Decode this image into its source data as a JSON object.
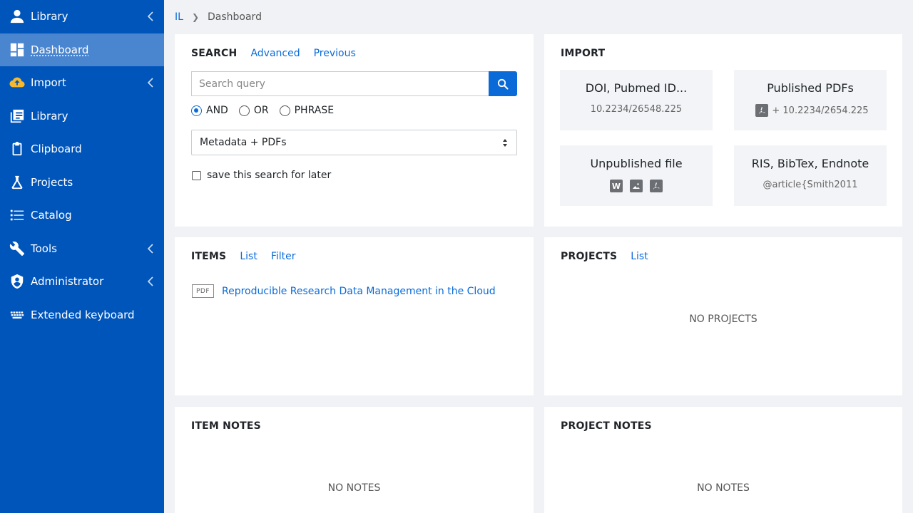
{
  "sidebar": {
    "items": [
      {
        "label": "Library",
        "icon": "user-icon",
        "expandable": true,
        "active": false
      },
      {
        "label": "Dashboard",
        "icon": "dashboard-icon",
        "expandable": false,
        "active": true
      },
      {
        "label": "Import",
        "icon": "cloud-upload-icon",
        "expandable": true,
        "active": false
      },
      {
        "label": "Library",
        "icon": "books-icon",
        "expandable": false,
        "active": false
      },
      {
        "label": "Clipboard",
        "icon": "clipboard-icon",
        "expandable": false,
        "active": false
      },
      {
        "label": "Projects",
        "icon": "flask-icon",
        "expandable": false,
        "active": false
      },
      {
        "label": "Catalog",
        "icon": "list-icon",
        "expandable": false,
        "active": false
      },
      {
        "label": "Tools",
        "icon": "wrench-icon",
        "expandable": true,
        "active": false
      },
      {
        "label": "Administrator",
        "icon": "shield-user-icon",
        "expandable": true,
        "active": false
      },
      {
        "label": "Extended keyboard",
        "icon": "keyboard-icon",
        "expandable": false,
        "active": false
      }
    ]
  },
  "breadcrumb": {
    "root": "IL",
    "current": "Dashboard"
  },
  "search": {
    "title": "SEARCH",
    "advanced_link": "Advanced",
    "previous_link": "Previous",
    "placeholder": "Search query",
    "options": [
      "AND",
      "OR",
      "PHRASE"
    ],
    "selected_option": "AND",
    "scope": "Metadata + PDFs",
    "save_label": "save this search for later"
  },
  "import": {
    "title": "IMPORT",
    "tiles": [
      {
        "title": "DOI, Pubmed ID...",
        "sub": "10.2234/26548.225"
      },
      {
        "title": "Published PDFs",
        "sub": "+ 10.2234/2654.225"
      },
      {
        "title": "Unpublished file",
        "sub": ""
      },
      {
        "title": "RIS, BibTex, Endnote",
        "sub": "@article{Smith2011"
      }
    ]
  },
  "items": {
    "title": "ITEMS",
    "list_link": "List",
    "filter_link": "Filter",
    "entries": [
      {
        "type": "PDF",
        "title": "Reproducible Research Data Management in the Cloud"
      }
    ]
  },
  "projects": {
    "title": "PROJECTS",
    "list_link": "List",
    "empty": "NO PROJECTS"
  },
  "item_notes": {
    "title": "ITEM NOTES",
    "empty": "NO NOTES"
  },
  "project_notes": {
    "title": "PROJECT NOTES",
    "empty": "NO NOTES"
  },
  "colors": {
    "sidebar": "#0055bb",
    "sidebar_active": "#4a86d0",
    "accent": "#0a6bd8",
    "background": "#f0f2f5"
  }
}
